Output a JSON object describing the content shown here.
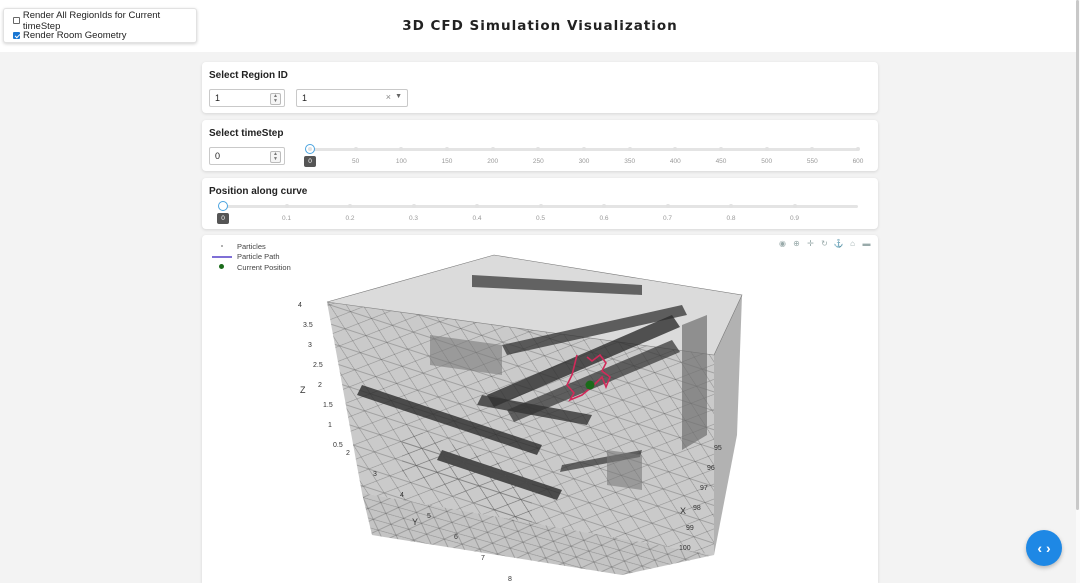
{
  "options": {
    "render_all_label": "Render All RegionIds for Current timeStep",
    "render_all_checked": false,
    "render_room_label": "Render Room Geometry",
    "render_room_checked": true
  },
  "header": {
    "title": "3D CFD Simulation Visualization"
  },
  "region": {
    "heading": "Select Region ID",
    "input_value": "1",
    "dropdown_value": "1",
    "clear_icon": "clear-icon",
    "caret_icon": "chevron-down-icon"
  },
  "timestep": {
    "heading": "Select timeStep",
    "input_value": "0",
    "slider_value": "0",
    "ticks": [
      "0",
      "50",
      "100",
      "150",
      "200",
      "250",
      "300",
      "350",
      "400",
      "450",
      "500",
      "550",
      "600"
    ]
  },
  "position": {
    "heading": "Position along curve",
    "slider_value": "0",
    "ticks": [
      "0.1",
      "0.2",
      "0.3",
      "0.4",
      "0.5",
      "0.6",
      "0.7",
      "0.8",
      "0.9"
    ]
  },
  "plot": {
    "legend": [
      "Particles",
      "Particle Path",
      "Current Position"
    ],
    "path_color": "#7f6fd6",
    "current_color": "#1a6b1a",
    "toolbar_icons": [
      "camera-icon",
      "zoom-icon",
      "pan-icon",
      "orbit-icon",
      "turntable-icon",
      "home-icon",
      "reset-camera-icon"
    ],
    "z_label": "Z",
    "y_label": "Y",
    "x_label": "X",
    "z_ticks": [
      "4",
      "3.5",
      "3",
      "2.5",
      "2",
      "1.5",
      "1",
      "0.5"
    ],
    "y_ticks": [
      "2",
      "3",
      "4",
      "5",
      "6",
      "7",
      "8"
    ],
    "x_ticks": [
      "95",
      "96",
      "97",
      "98",
      "99",
      "100"
    ]
  },
  "fab_icon": "code-icon",
  "fab_label": "‹ ›"
}
